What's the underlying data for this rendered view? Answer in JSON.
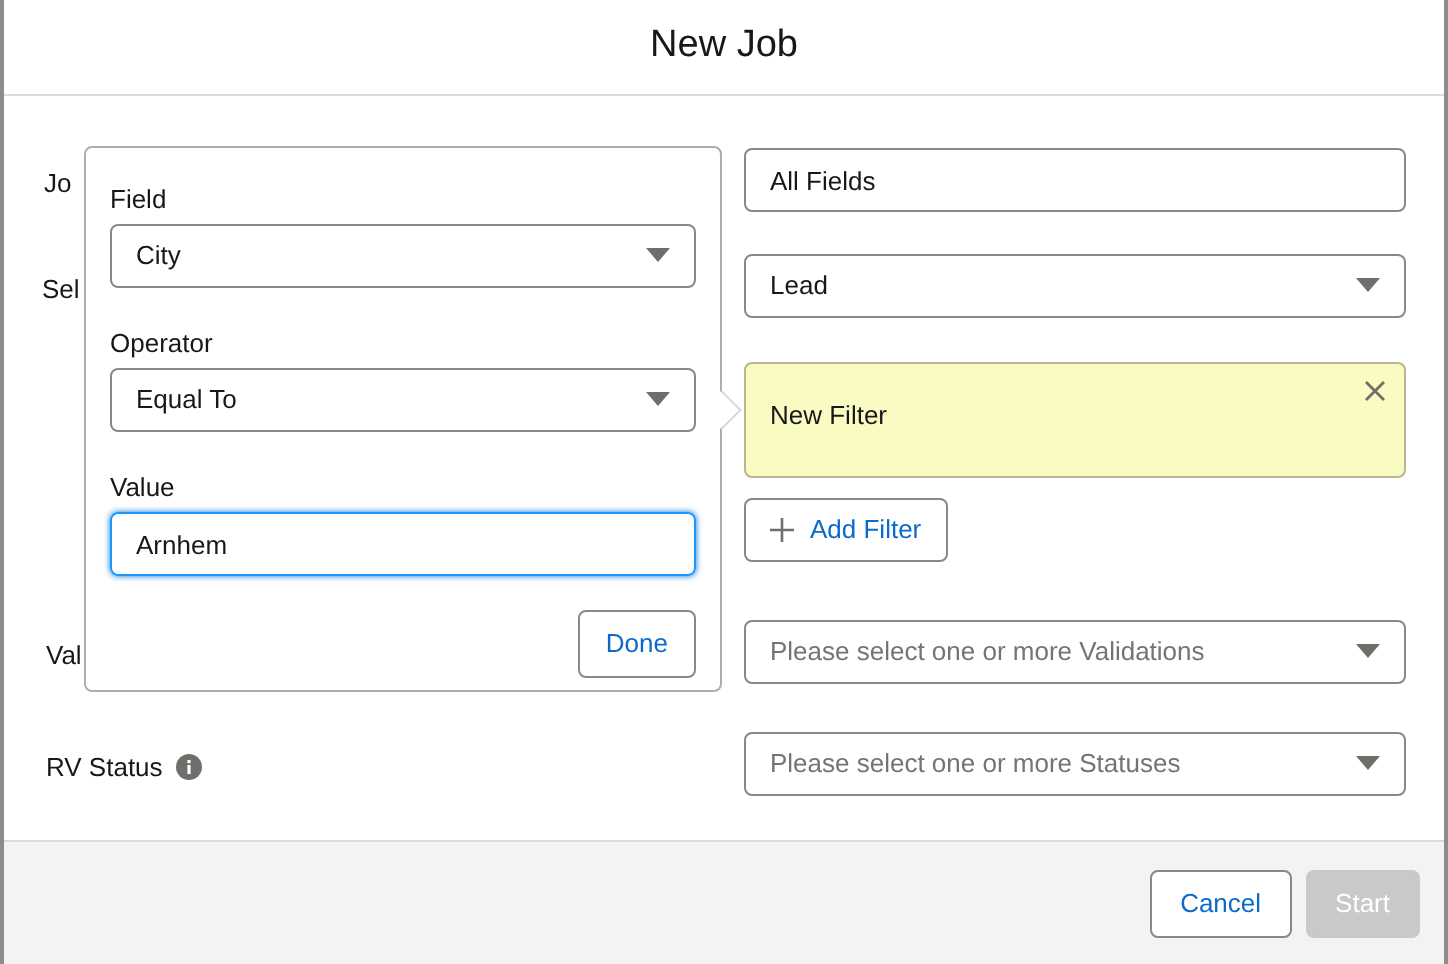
{
  "dialog": {
    "title": "New Job"
  },
  "job": {
    "label": "Jo",
    "value": "All Fields"
  },
  "object": {
    "label": "Sel",
    "value": "Lead"
  },
  "filters": [
    {
      "label": "New Filter",
      "selected": true
    }
  ],
  "add_filter_button": "Add Filter",
  "validations": {
    "label": "Val",
    "placeholder": "Please select one or more Validations"
  },
  "rv_status": {
    "label": "RV Status",
    "placeholder": "Please select one or more Statuses"
  },
  "filter_popover": {
    "field": {
      "label": "Field",
      "value": "City"
    },
    "operator": {
      "label": "Operator",
      "value": "Equal To"
    },
    "value": {
      "label": "Value",
      "value": "Arnhem",
      "focused": true
    },
    "done_button": "Done"
  },
  "footer": {
    "buttons": [
      {
        "label": "Cancel",
        "disabled": false
      },
      {
        "label": "Start",
        "disabled": true
      }
    ]
  }
}
